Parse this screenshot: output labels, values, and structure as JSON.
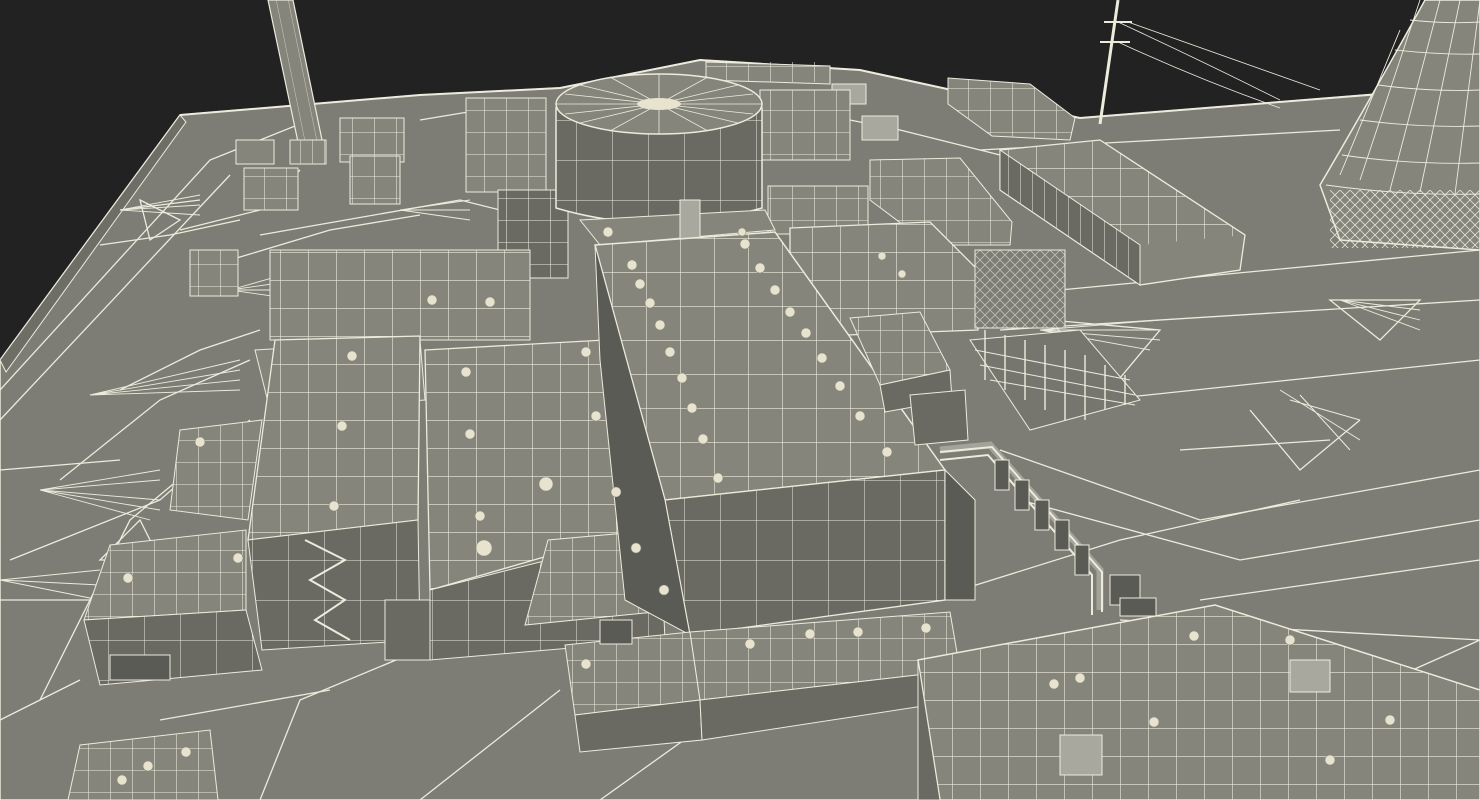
{
  "scene": {
    "colors": {
      "sky": "#222222",
      "ground": "#7d7d75",
      "ground_dark": "#6e6e67",
      "roof": "#85857c",
      "wall": "#6a6a63",
      "wall_dark": "#5b5b55",
      "line": "#ecebdc",
      "vent": "#e7e3cf"
    }
  }
}
